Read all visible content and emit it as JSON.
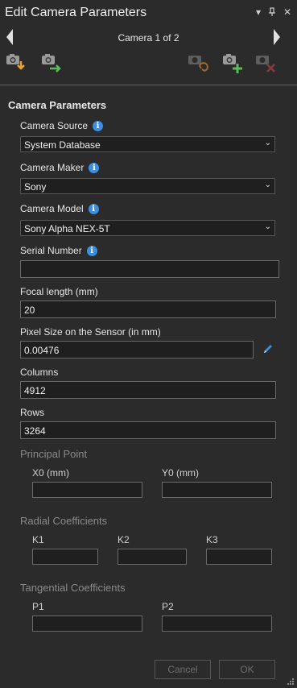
{
  "window": {
    "title": "Edit Camera Parameters"
  },
  "navigation": {
    "text": "Camera 1 of 2"
  },
  "icons": {
    "import": "camera-import-icon",
    "export": "camera-export-icon",
    "refresh": "camera-refresh-icon",
    "add": "camera-add-icon",
    "delete": "camera-delete-icon",
    "info": "info-icon",
    "pencil": "pencil-icon"
  },
  "colors": {
    "info": "#3b8fe0",
    "add": "#5cb85c",
    "import": "#f0a030",
    "delete": "#c05050"
  },
  "section_title": "Camera Parameters",
  "fields": {
    "camera_source": {
      "label": "Camera Source",
      "value": "System Database"
    },
    "camera_maker": {
      "label": "Camera Maker",
      "value": "Sony"
    },
    "camera_model": {
      "label": "Camera Model",
      "value": "Sony Alpha NEX-5T"
    },
    "serial_number": {
      "label": "Serial Number",
      "value": ""
    },
    "focal_length": {
      "label": "Focal length (mm)",
      "value": "20"
    },
    "pixel_size": {
      "label": "Pixel Size on the Sensor (in mm)",
      "value": "0.00476"
    },
    "columns": {
      "label": "Columns",
      "value": "4912"
    },
    "rows": {
      "label": "Rows",
      "value": "3264"
    }
  },
  "principal_point": {
    "title": "Principal Point",
    "x0_label": "X0 (mm)",
    "y0_label": "Y0 (mm)",
    "x0": "",
    "y0": ""
  },
  "radial": {
    "title": "Radial Coefficients",
    "k1_label": "K1",
    "k2_label": "K2",
    "k3_label": "K3",
    "k1": "",
    "k2": "",
    "k3": ""
  },
  "tangential": {
    "title": "Tangential Coefficients",
    "p1_label": "P1",
    "p2_label": "P2",
    "p1": "",
    "p2": ""
  },
  "buttons": {
    "cancel": "Cancel",
    "ok": "OK"
  },
  "window_controls": {
    "dropdown": "▾",
    "pin": "⊥",
    "close": "✕"
  }
}
